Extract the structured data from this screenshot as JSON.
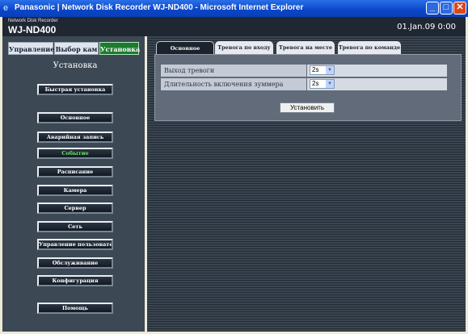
{
  "window": {
    "title": "Panasonic | Network Disk Recorder WJ-ND400 - Microsoft Internet Explorer",
    "min_glyph": "_",
    "max_glyph": "□",
    "close_glyph": "✕",
    "icon_glyph": "e"
  },
  "header": {
    "subtitle": "Network Disk Recorder",
    "model": "WJ-ND400",
    "datetime": "01.Jan.09  0:00"
  },
  "left_tabs": [
    {
      "label": "Управление"
    },
    {
      "label": "Выбор кам"
    },
    {
      "label": "Установка"
    }
  ],
  "left_title": "Установка",
  "menu": {
    "quick": "Быстрая установка",
    "items": [
      {
        "label": "Основное"
      },
      {
        "label": "Аварийная запись"
      },
      {
        "label": "Событие"
      },
      {
        "label": "Расписание"
      },
      {
        "label": "Камера"
      },
      {
        "label": "Сервер"
      },
      {
        "label": "Сеть"
      },
      {
        "label": "Управление пользователем"
      },
      {
        "label": "Обслуживание"
      },
      {
        "label": "Конфигурация"
      }
    ],
    "help": "Помощь"
  },
  "right_tabs": [
    {
      "label": "Основное"
    },
    {
      "label": "Тревога по входу"
    },
    {
      "label": "Тревога на месте"
    },
    {
      "label": "Тревога по команде"
    }
  ],
  "settings": [
    {
      "label": "Выход тревоги",
      "value": "2s"
    },
    {
      "label": "Длительность включения зуммера",
      "value": "2s"
    }
  ],
  "set_button": "Установить",
  "colors": {
    "active_tab": "#1f7a30",
    "active_menu_text": "#65e365",
    "panel_bg": "#616b79"
  }
}
